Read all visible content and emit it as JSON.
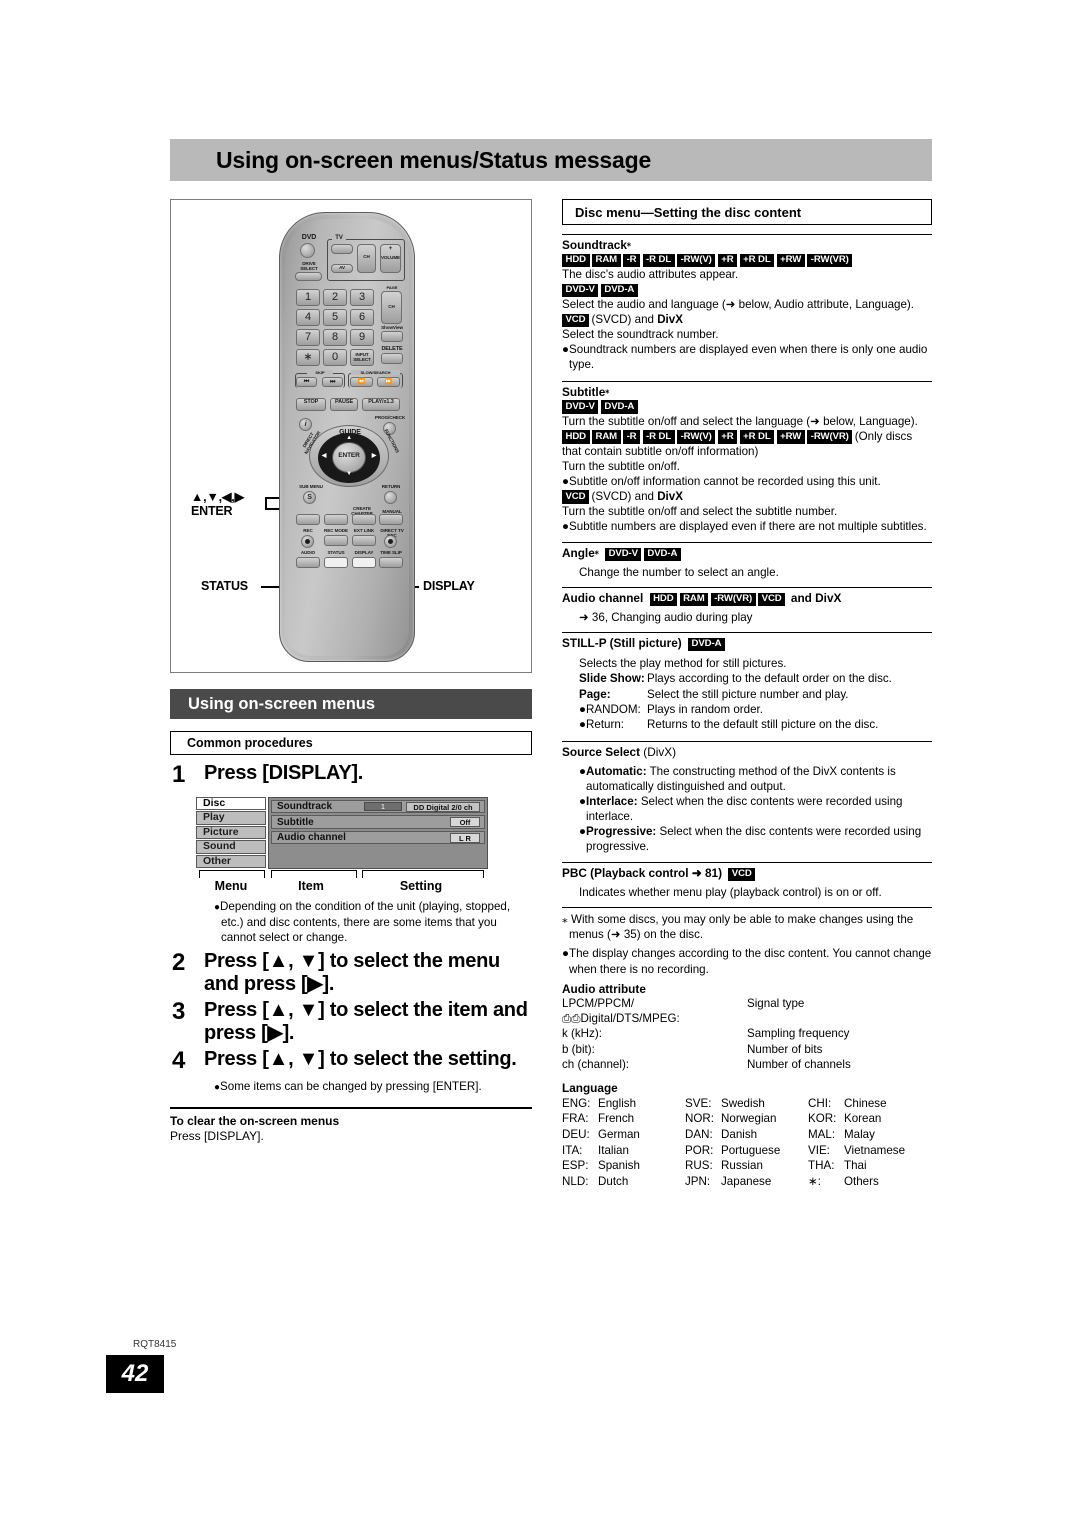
{
  "page": {
    "title": "Using on-screen menus/Status message",
    "doc_code": "RQT8415",
    "page_number": "42"
  },
  "remote": {
    "callout_enter": "▲,▼,◀,▶",
    "callout_enter2": "ENTER",
    "callout_status": "STATUS",
    "callout_display": "DISPLAY",
    "keys": {
      "dvd": "DVD",
      "tv": "TV",
      "drive_select": "DRIVE\nSELECT",
      "av": "AV",
      "ch": "CH",
      "volume": "VOLUME",
      "plus": "+",
      "minus": "−",
      "page": "PAGE",
      "showview": "ShowView",
      "delete": "DELETE",
      "input_select": "INPUT\nSELECT",
      "star": "∗",
      "skip": "SKIP",
      "slow_search": "SLOW/SEARCH",
      "stop": "STOP",
      "pause": "PAUSE",
      "play": "PLAY/x1.3",
      "prog_check": "PROG/CHECK",
      "guide": "GUIDE",
      "direct_navigator": "DIRECT NAVIGATOR",
      "functions": "FUNCTIONS",
      "enter": "ENTER",
      "sub_menu": "SUB MENU",
      "sub_menu_btn": "S",
      "return": "RETURN",
      "create_chapter": "CREATE\nCHAPTER",
      "manual_skip": "MANUAL SKIP",
      "rec": "REC",
      "rec_mode": "REC MODE",
      "ext_link": "EXT LINK",
      "direct_tv_rec": "DIRECT TV REC",
      "audio": "AUDIO",
      "status": "STATUS",
      "display": "DISPLAY",
      "time_slip": "TIME SLIP",
      "numbers": [
        "1",
        "2",
        "3",
        "4",
        "5",
        "6",
        "7",
        "8",
        "9",
        "0"
      ]
    }
  },
  "left": {
    "sub_banner": "Using on-screen menus",
    "common_procedures": "Common procedures",
    "steps": [
      {
        "n": "1",
        "text": "Press [DISPLAY]."
      },
      {
        "n": "2",
        "text": "Press [▲, ▼] to select the menu and press [▶]."
      },
      {
        "n": "3",
        "text": "Press [▲, ▼] to select the item and press [▶]."
      },
      {
        "n": "4",
        "text": "Press [▲, ▼] to select the setting."
      }
    ],
    "note_after_step1": "Depending on the condition of the unit (playing, stopped, etc.) and disc contents, there are some items that you cannot select or change.",
    "note_after_step4": "Some items can be changed by pressing [ENTER].",
    "clear_heading": "To clear the on-screen menus",
    "clear_body": "Press [DISPLAY].",
    "osd": {
      "menus": [
        "Disc",
        "Play",
        "Picture",
        "Sound",
        "Other"
      ],
      "selected_menu": "Disc",
      "rows": [
        {
          "item": "Soundtrack",
          "value1": "1",
          "value2": "DD Digital  2/0 ch",
          "setting": ""
        },
        {
          "item": "Subtitle",
          "value1": "",
          "value2": "",
          "setting": "Off"
        },
        {
          "item": "Audio channel",
          "value1": "",
          "value2": "",
          "setting": "L R"
        }
      ],
      "captions": [
        "Menu",
        "Item",
        "Setting"
      ]
    }
  },
  "right": {
    "header": "Disc menu—Setting the disc content",
    "sections": [
      {
        "id": "soundtrack",
        "title": "Soundtrack",
        "title_sup": "⁎",
        "badges_1": [
          "HDD",
          "RAM",
          "-R",
          "-R DL",
          "-RW(V)",
          "+R",
          "+R DL",
          "+RW",
          "-RW(VR)"
        ],
        "line_1": "The disc's audio attributes appear.",
        "badges_2": [
          "DVD-V",
          "DVD-A"
        ],
        "line_2": "Select the audio and language (➜ below, Audio attribute, Language).",
        "badges_3": [
          "VCD"
        ],
        "line_3_prefix": "(SVCD) and ",
        "line_3_bold": "DivX",
        "line_4": "Select the soundtrack number.",
        "bullet_1": "Soundtrack numbers are displayed even when there is only one audio type."
      },
      {
        "id": "subtitle",
        "title": "Subtitle",
        "title_sup": "⁎",
        "badges_1": [
          "DVD-V",
          "DVD-A"
        ],
        "line_1": "Turn the subtitle on/off and select the language (➜ below, Language).",
        "badges_2": [
          "HDD",
          "RAM",
          "-R",
          "-R DL",
          "-RW(V)",
          "+R",
          "+R DL",
          "+RW",
          "-RW(VR)"
        ],
        "line_2": "(Only discs that contain subtitle on/off information)",
        "line_3": "Turn the subtitle on/off.",
        "bullet_1": "Subtitle on/off information cannot be recorded using this unit.",
        "badges_3": [
          "VCD"
        ],
        "line_4_prefix": "(SVCD) and ",
        "line_4_bold": "DivX",
        "line_5": "Turn the subtitle on/off and select the subtitle number.",
        "bullet_2": "Subtitle numbers are displayed even if there are not multiple subtitles."
      },
      {
        "id": "angle",
        "title": "Angle",
        "title_sup": "⁎",
        "badges_1": [
          "DVD-V",
          "DVD-A"
        ],
        "line_1": "Change the number to select an angle."
      },
      {
        "id": "audio-channel",
        "title": "Audio channel",
        "badges_1": [
          "HDD",
          "RAM",
          "-RW(VR)",
          "VCD"
        ],
        "title_suffix": " and DivX",
        "line_1": "➜ 36, Changing audio during play"
      },
      {
        "id": "still-p",
        "title": "STILL-P (Still picture)",
        "badges_1": [
          "DVD-A"
        ],
        "line_1": "Selects the play method for still pictures.",
        "defs": [
          {
            "k": "Slide Show:",
            "v": "Plays according to the default order on the disc.",
            "bold": true
          },
          {
            "k": "Page:",
            "v": "Select the still picture number and play.",
            "bold": true
          },
          {
            "k": "●RANDOM:",
            "v": "Plays in random order.",
            "bold": false
          },
          {
            "k": "●Return:",
            "v": "Returns to the default still picture on the disc.",
            "bold": false
          }
        ]
      },
      {
        "id": "source-select",
        "title": "Source Select",
        "title_suffix": " (DivX)",
        "opts": [
          {
            "k": "Automatic:",
            "v": "The constructing method of the DivX contents is automatically distinguished and output."
          },
          {
            "k": "Interlace:",
            "v": "Select when the disc contents were recorded using interlace."
          },
          {
            "k": "Progressive:",
            "v": "Select when the disc contents were recorded using progressive."
          }
        ]
      },
      {
        "id": "pbc",
        "title": "PBC (Playback control ➜ 81)",
        "badges_1": [
          "VCD"
        ],
        "line_1": "Indicates whether menu play (playback control) is on or off."
      }
    ],
    "footnote_star": "With some discs, you may only be able to make changes using the menus (➜ 35) on the disc.",
    "footnote_bullet": "The display changes according to the disc content. You cannot change when there is no recording.",
    "audio_attribute": {
      "heading": "Audio attribute",
      "rows": [
        {
          "k": "LPCM/PPCM/⎙⎙Digital/DTS/MPEG:",
          "v": "Signal type"
        },
        {
          "k": "k (kHz):",
          "v": "Sampling frequency"
        },
        {
          "k": "b (bit):",
          "v": "Number of bits"
        },
        {
          "k": "ch (channel):",
          "v": "Number of channels"
        }
      ]
    },
    "language": {
      "heading": "Language",
      "columns": [
        [
          {
            "code": "ENG:",
            "name": "English"
          },
          {
            "code": "FRA:",
            "name": "French"
          },
          {
            "code": "DEU:",
            "name": "German"
          },
          {
            "code": "ITA:",
            "name": "Italian"
          },
          {
            "code": "ESP:",
            "name": "Spanish"
          },
          {
            "code": "NLD:",
            "name": "Dutch"
          }
        ],
        [
          {
            "code": "SVE:",
            "name": "Swedish"
          },
          {
            "code": "NOR:",
            "name": "Norwegian"
          },
          {
            "code": "DAN:",
            "name": "Danish"
          },
          {
            "code": "POR:",
            "name": "Portuguese"
          },
          {
            "code": "RUS:",
            "name": "Russian"
          },
          {
            "code": "JPN:",
            "name": "Japanese"
          }
        ],
        [
          {
            "code": "CHI:",
            "name": "Chinese"
          },
          {
            "code": "KOR:",
            "name": "Korean"
          },
          {
            "code": "MAL:",
            "name": "Malay"
          },
          {
            "code": "VIE:",
            "name": "Vietnamese"
          },
          {
            "code": "THA:",
            "name": "Thai"
          },
          {
            "code": "∗:",
            "name": "Others"
          }
        ]
      ]
    }
  }
}
